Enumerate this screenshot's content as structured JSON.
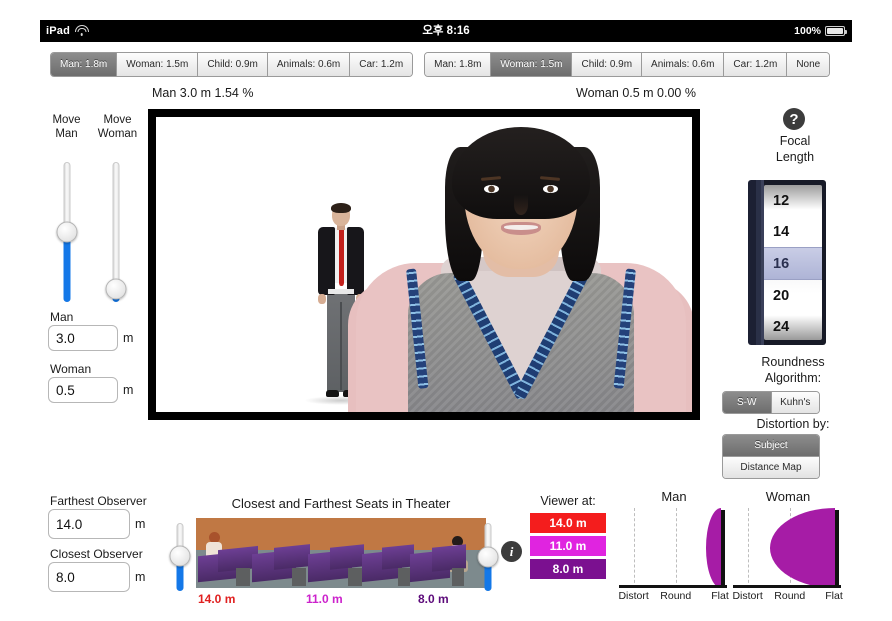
{
  "status_bar": {
    "device": "iPad",
    "wifi_icon": "wifi-icon",
    "time": "오후 8:16",
    "battery_percent": "100%",
    "battery_icon": "battery-icon"
  },
  "segmented_left": {
    "items": [
      "Man: 1.8m",
      "Woman: 1.5m",
      "Child: 0.9m",
      "Animals: 0.6m",
      "Car: 1.2m"
    ],
    "selected_index": 0
  },
  "segmented_right": {
    "items": [
      "Man: 1.8m",
      "Woman: 1.5m",
      "Child: 0.9m",
      "Animals: 0.6m",
      "Car: 1.2m",
      "None"
    ],
    "selected_index": 1
  },
  "readouts": {
    "man": "Man 3.0 m  1.54 %",
    "woman": "Woman 0.5 m  0.00 %"
  },
  "move_sliders": {
    "man_label_line1": "Move",
    "man_label_line2": "Man",
    "woman_label_line1": "Move",
    "woman_label_line2": "Woman",
    "man_value_fraction": 0.5,
    "woman_value_fraction": 0.09
  },
  "fields": {
    "man": {
      "label": "Man",
      "value": "3.0",
      "unit": "m"
    },
    "woman": {
      "label": "Woman",
      "value": "0.5",
      "unit": "m"
    },
    "farthest": {
      "label": "Farthest Observer",
      "value": "14.0",
      "unit": "m"
    },
    "closest": {
      "label": "Closest Observer",
      "value": "8.0",
      "unit": "m"
    }
  },
  "focal_length": {
    "help_icon": "question-mark-icon",
    "help_glyph": "?",
    "title_line1": "Focal",
    "title_line2": "Length",
    "options": [
      "12",
      "14",
      "16",
      "20",
      "24"
    ],
    "selected": "16"
  },
  "roundness": {
    "title_line1": "Roundness",
    "title_line2": "Algorithm:",
    "options": [
      "S-W",
      "Kuhn's"
    ],
    "selected_index": 0
  },
  "distortion": {
    "title": "Distortion by:",
    "options": [
      "Subject",
      "Distance Map"
    ],
    "selected_index": 0
  },
  "theater": {
    "title": "Closest and Farthest Seats in Theater",
    "distances": [
      "14.0 m",
      "11.0 m",
      "8.0 m"
    ],
    "distance_colors": [
      "#e02020",
      "#cc22cc",
      "#5c0a7a"
    ],
    "left_slider_fraction": 0.52,
    "right_slider_fraction": 0.5
  },
  "viewer": {
    "info_icon": "info-icon",
    "info_glyph": "i",
    "title": "Viewer at:",
    "buttons": [
      {
        "label": "14.0 m",
        "color": "#f41d1d"
      },
      {
        "label": "11.0 m",
        "color": "#e024e0"
      },
      {
        "label": "8.0 m",
        "color": "#7b1090"
      }
    ]
  },
  "chart_data": [
    {
      "type": "area",
      "title": "Man",
      "xlabel": "",
      "ylabel": "",
      "tick_labels": [
        "Distort",
        "Round",
        "Flat"
      ],
      "tick_positions": [
        0.08,
        0.47,
        0.88
      ],
      "gridlines": [
        0.08,
        0.47
      ],
      "series": [
        {
          "name": "roundness",
          "value": 0.93,
          "shape": "half-ellipse",
          "width_fraction": 0.14,
          "height_fraction": 1.0,
          "color": "#a61ca6"
        }
      ],
      "xlim": [
        0,
        1
      ],
      "grid": true
    },
    {
      "type": "area",
      "title": "Woman",
      "xlabel": "",
      "ylabel": "",
      "tick_labels": [
        "Distort",
        "Round",
        "Flat"
      ],
      "tick_positions": [
        0.08,
        0.47,
        0.88
      ],
      "gridlines": [
        0.08,
        0.47
      ],
      "series": [
        {
          "name": "roundness",
          "value": 0.55,
          "shape": "half-ellipse",
          "width_fraction": 0.6,
          "height_fraction": 1.0,
          "color": "#a61ca6"
        }
      ],
      "xlim": [
        0,
        1
      ],
      "grid": true
    }
  ]
}
